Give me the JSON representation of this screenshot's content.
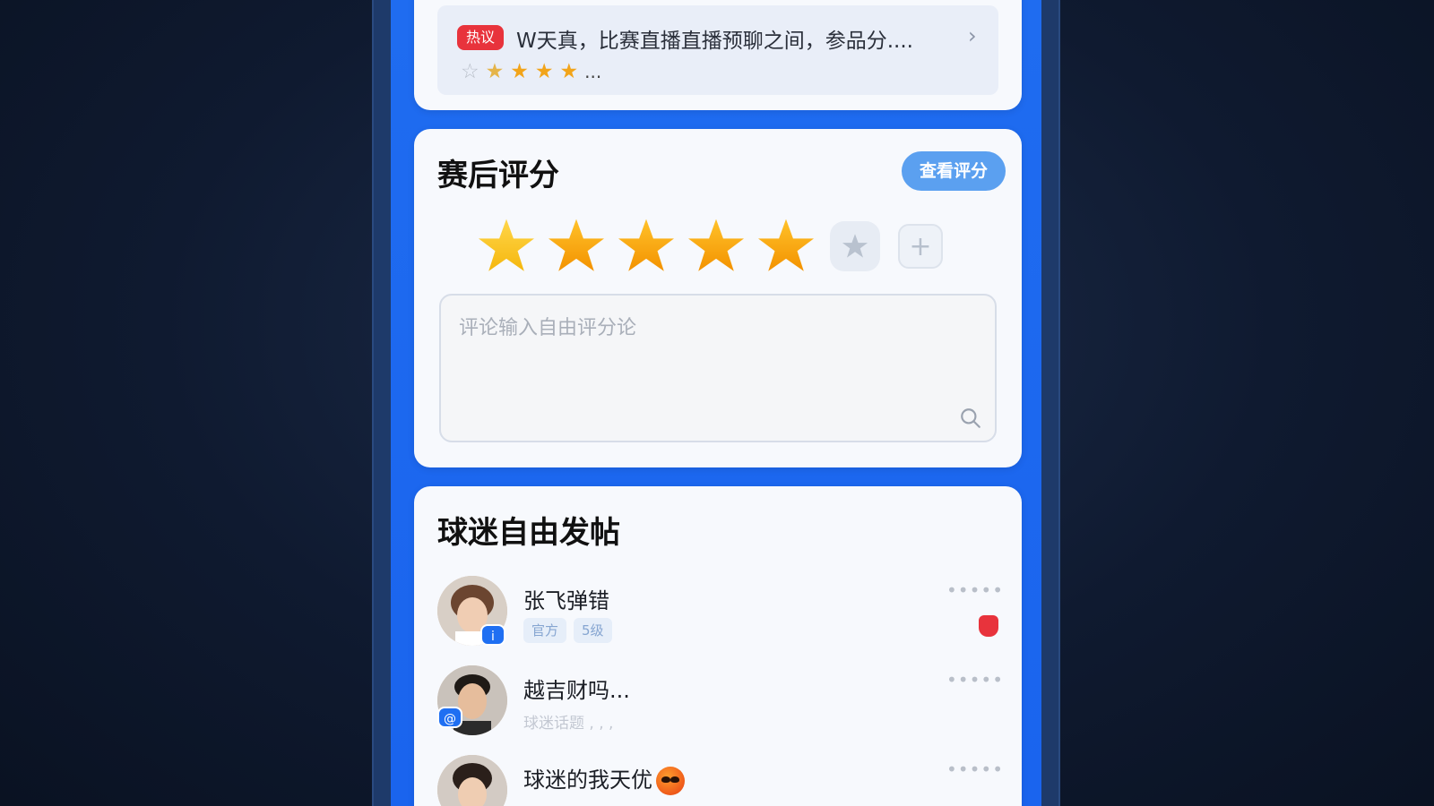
{
  "top_notice": {
    "badge": "热议",
    "text": "W天真，比赛直播直播预聊之间，参品分....",
    "arrow": "›",
    "stars": [
      "☆",
      "★",
      "★",
      "★",
      "★"
    ],
    "more": "..."
  },
  "rating": {
    "title": "赛后评分",
    "button": "查看评分",
    "stars_filled": 5,
    "add_icon": "+",
    "comment_placeholder": "评论输入自由评分论"
  },
  "posts": {
    "title": "球迷自由发帖",
    "items": [
      {
        "name": "张飞弹错",
        "tags": [
          "官方",
          "5级"
        ],
        "badge": "i",
        "more": "•••••"
      },
      {
        "name": "越吉财吗...",
        "subtitle": "球迷话题 , , ,",
        "badge": "@",
        "more": "•••••"
      },
      {
        "name": "球迷的我天优",
        "more": "•••••"
      }
    ]
  },
  "colors": {
    "brand_blue": "#1f6cf0",
    "badge_red": "#e8333c",
    "star_gold": "#f7a600",
    "button_blue": "#5ba0f0"
  }
}
